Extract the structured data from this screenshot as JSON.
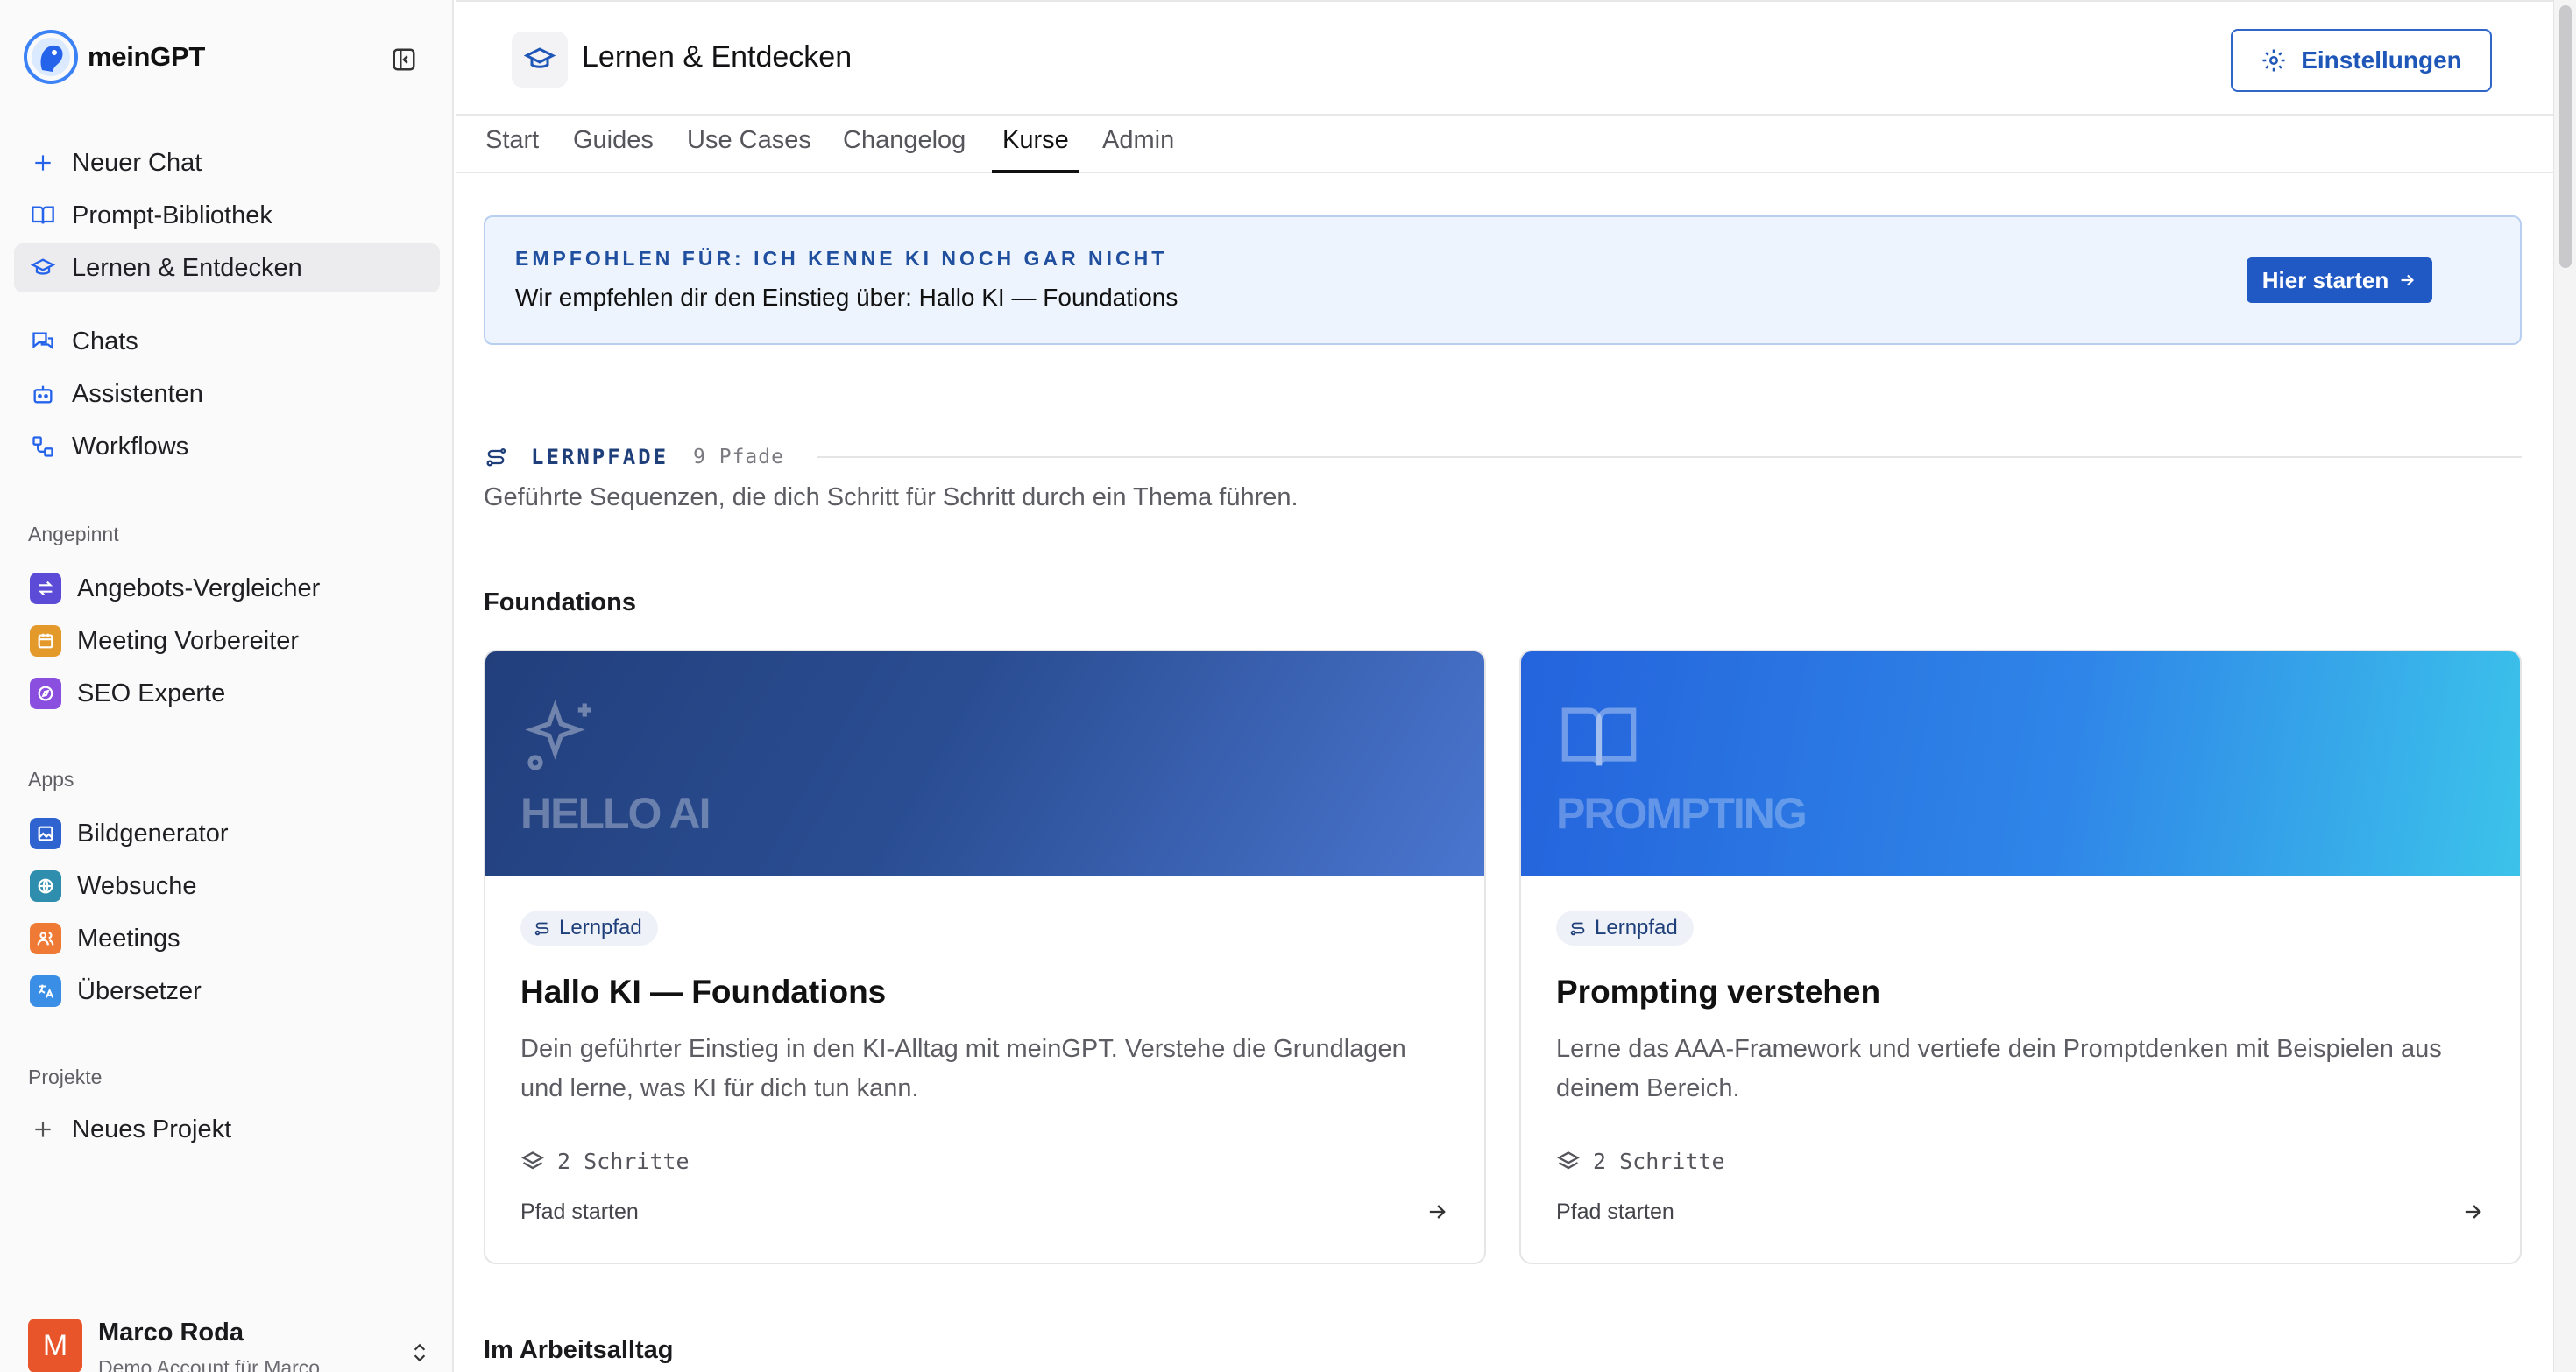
{
  "brand": {
    "name": "meinGPT"
  },
  "sidebar": {
    "main_items": [
      {
        "label": "Neuer Chat",
        "icon": "plus-icon"
      },
      {
        "label": "Prompt-Bibliothek",
        "icon": "book-open-icon"
      },
      {
        "label": "Lernen & Entdecken",
        "icon": "graduation-cap-icon",
        "active": true
      }
    ],
    "tool_items": [
      {
        "label": "Chats",
        "icon": "chats-icon"
      },
      {
        "label": "Assistenten",
        "icon": "bot-icon"
      },
      {
        "label": "Workflows",
        "icon": "workflow-icon"
      }
    ],
    "pinned_label": "Angepinnt",
    "pinned": [
      {
        "label": "Angebots-Vergleicher",
        "color": "#5b4bd6"
      },
      {
        "label": "Meeting Vorbereiter",
        "color": "#e39a2b"
      },
      {
        "label": "SEO Experte",
        "color": "#8b4fe0"
      }
    ],
    "apps_label": "Apps",
    "apps": [
      {
        "label": "Bildgenerator",
        "color": "#2f63cf"
      },
      {
        "label": "Websuche",
        "color": "#2f8dae"
      },
      {
        "label": "Meetings",
        "color": "#ef7a35"
      },
      {
        "label": "Übersetzer",
        "color": "#3a8ee6"
      }
    ],
    "projects_label": "Projekte",
    "new_project": "Neues Projekt",
    "user": {
      "initial": "M",
      "name": "Marco Roda",
      "sub": "Demo Account für Marco"
    }
  },
  "header": {
    "title": "Lernen & Entdecken",
    "settings_label": "Einstellungen"
  },
  "tabs": [
    {
      "label": "Start"
    },
    {
      "label": "Guides"
    },
    {
      "label": "Use Cases"
    },
    {
      "label": "Changelog"
    },
    {
      "label": "Kurse",
      "active": true
    },
    {
      "label": "Admin"
    }
  ],
  "banner": {
    "label": "EMPFOHLEN FÜR: ICH KENNE KI NOCH GAR NICHT",
    "text": "Wir empfehlen dir den Einstieg über: Hallo KI — Foundations",
    "button": "Hier starten"
  },
  "lernpfade": {
    "title": "LERNPFADE",
    "count": "9 Pfade",
    "description": "Geführte Sequenzen, die dich Schritt für Schritt durch ein Thema führen."
  },
  "groups": {
    "foundations": "Foundations",
    "arbeitsalltag": "Im Arbeitsalltag"
  },
  "cards": [
    {
      "hero_text": "HELLO AI",
      "badge": "Lernpfad",
      "title": "Hallo KI — Foundations",
      "description": "Dein geführter Einstieg in den KI-Alltag mit meinGPT. Verstehe die Grundlagen und lerne, was KI für dich tun kann.",
      "steps": "2 Schritte",
      "start": "Pfad starten",
      "gradient_from": "#223f7c",
      "gradient_to": "#4a76d0"
    },
    {
      "hero_text": "PROMPTING",
      "badge": "Lernpfad",
      "title": "Prompting verstehen",
      "description": "Lerne das AAA-Framework und vertiefe dein Promptdenken mit Beispielen aus deinem Bereich.",
      "steps": "2 Schritte",
      "start": "Pfad starten",
      "gradient_from": "#2463dc",
      "gradient_to": "#3cc3ea"
    }
  ]
}
